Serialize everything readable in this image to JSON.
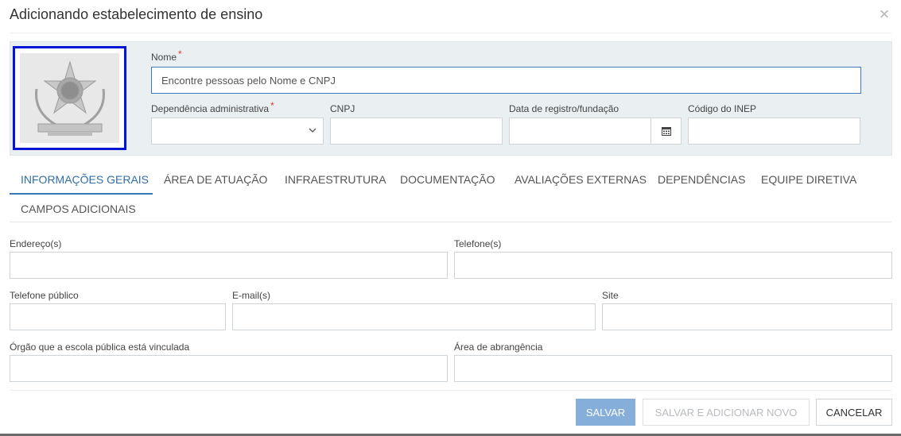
{
  "modal": {
    "title": "Adicionando estabelecimento de ensino",
    "close_symbol": "×"
  },
  "header_form": {
    "nome_label": "Nome",
    "nome_placeholder": "Encontre pessoas pelo Nome e CNPJ",
    "dependencia_label": "Dependência administrativa",
    "cnpj_label": "CNPJ",
    "data_label": "Data de registro/fundação",
    "inep_label": "Código do INEP",
    "required_mark": "*"
  },
  "tabs": [
    {
      "label": "INFORMAÇÕES GERAIS",
      "active": true
    },
    {
      "label": "ÁREA DE ATUAÇÃO",
      "active": false
    },
    {
      "label": "INFRAESTRUTURA",
      "active": false
    },
    {
      "label": "DOCUMENTAÇÃO",
      "active": false
    },
    {
      "label": "AVALIAÇÕES EXTERNAS",
      "active": false
    },
    {
      "label": "DEPENDÊNCIAS",
      "active": false
    },
    {
      "label": "EQUIPE DIRETIVA",
      "active": false
    },
    {
      "label": "CAMPOS ADICIONAIS",
      "active": false
    }
  ],
  "general_form": {
    "enderecos_label": "Endereço(s)",
    "telefones_label": "Telefone(s)",
    "telefone_publico_label": "Telefone público",
    "emails_label": "E-mail(s)",
    "site_label": "Site",
    "orgao_label": "Órgão que a escola pública está vinculada",
    "area_label": "Área de abrangência"
  },
  "footer": {
    "save_label": "SALVAR",
    "save_new_label": "SALVAR E ADICIONAR NOVO",
    "cancel_label": "CANCELAR"
  },
  "colors": {
    "accent": "#2f6ea9",
    "primary_button": "#85aedb",
    "logo_border": "#0015d6",
    "required": "#e53935"
  },
  "icons": {
    "close": "close-icon",
    "select": "chevron-down-icon",
    "calendar": "calendar-icon",
    "logo": "brasao-emblem"
  }
}
